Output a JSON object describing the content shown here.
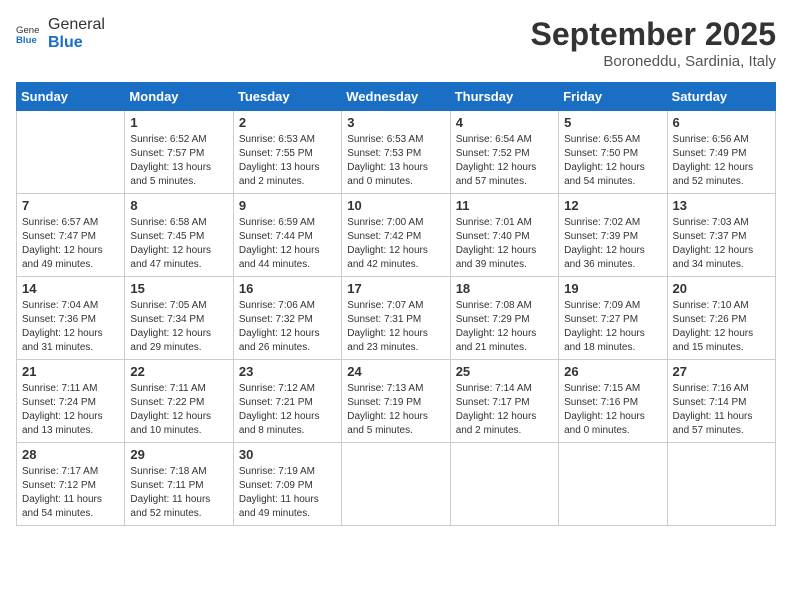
{
  "header": {
    "logo": {
      "general": "General",
      "blue": "Blue",
      "icon_color": "#1a6fc4"
    },
    "title": "September 2025",
    "location": "Boroneddu, Sardinia, Italy"
  },
  "calendar": {
    "days_of_week": [
      "Sunday",
      "Monday",
      "Tuesday",
      "Wednesday",
      "Thursday",
      "Friday",
      "Saturday"
    ],
    "weeks": [
      [
        {
          "day": "",
          "info": ""
        },
        {
          "day": "1",
          "info": "Sunrise: 6:52 AM\nSunset: 7:57 PM\nDaylight: 13 hours\nand 5 minutes."
        },
        {
          "day": "2",
          "info": "Sunrise: 6:53 AM\nSunset: 7:55 PM\nDaylight: 13 hours\nand 2 minutes."
        },
        {
          "day": "3",
          "info": "Sunrise: 6:53 AM\nSunset: 7:53 PM\nDaylight: 13 hours\nand 0 minutes."
        },
        {
          "day": "4",
          "info": "Sunrise: 6:54 AM\nSunset: 7:52 PM\nDaylight: 12 hours\nand 57 minutes."
        },
        {
          "day": "5",
          "info": "Sunrise: 6:55 AM\nSunset: 7:50 PM\nDaylight: 12 hours\nand 54 minutes."
        },
        {
          "day": "6",
          "info": "Sunrise: 6:56 AM\nSunset: 7:49 PM\nDaylight: 12 hours\nand 52 minutes."
        }
      ],
      [
        {
          "day": "7",
          "info": "Sunrise: 6:57 AM\nSunset: 7:47 PM\nDaylight: 12 hours\nand 49 minutes."
        },
        {
          "day": "8",
          "info": "Sunrise: 6:58 AM\nSunset: 7:45 PM\nDaylight: 12 hours\nand 47 minutes."
        },
        {
          "day": "9",
          "info": "Sunrise: 6:59 AM\nSunset: 7:44 PM\nDaylight: 12 hours\nand 44 minutes."
        },
        {
          "day": "10",
          "info": "Sunrise: 7:00 AM\nSunset: 7:42 PM\nDaylight: 12 hours\nand 42 minutes."
        },
        {
          "day": "11",
          "info": "Sunrise: 7:01 AM\nSunset: 7:40 PM\nDaylight: 12 hours\nand 39 minutes."
        },
        {
          "day": "12",
          "info": "Sunrise: 7:02 AM\nSunset: 7:39 PM\nDaylight: 12 hours\nand 36 minutes."
        },
        {
          "day": "13",
          "info": "Sunrise: 7:03 AM\nSunset: 7:37 PM\nDaylight: 12 hours\nand 34 minutes."
        }
      ],
      [
        {
          "day": "14",
          "info": "Sunrise: 7:04 AM\nSunset: 7:36 PM\nDaylight: 12 hours\nand 31 minutes."
        },
        {
          "day": "15",
          "info": "Sunrise: 7:05 AM\nSunset: 7:34 PM\nDaylight: 12 hours\nand 29 minutes."
        },
        {
          "day": "16",
          "info": "Sunrise: 7:06 AM\nSunset: 7:32 PM\nDaylight: 12 hours\nand 26 minutes."
        },
        {
          "day": "17",
          "info": "Sunrise: 7:07 AM\nSunset: 7:31 PM\nDaylight: 12 hours\nand 23 minutes."
        },
        {
          "day": "18",
          "info": "Sunrise: 7:08 AM\nSunset: 7:29 PM\nDaylight: 12 hours\nand 21 minutes."
        },
        {
          "day": "19",
          "info": "Sunrise: 7:09 AM\nSunset: 7:27 PM\nDaylight: 12 hours\nand 18 minutes."
        },
        {
          "day": "20",
          "info": "Sunrise: 7:10 AM\nSunset: 7:26 PM\nDaylight: 12 hours\nand 15 minutes."
        }
      ],
      [
        {
          "day": "21",
          "info": "Sunrise: 7:11 AM\nSunset: 7:24 PM\nDaylight: 12 hours\nand 13 minutes."
        },
        {
          "day": "22",
          "info": "Sunrise: 7:11 AM\nSunset: 7:22 PM\nDaylight: 12 hours\nand 10 minutes."
        },
        {
          "day": "23",
          "info": "Sunrise: 7:12 AM\nSunset: 7:21 PM\nDaylight: 12 hours\nand 8 minutes."
        },
        {
          "day": "24",
          "info": "Sunrise: 7:13 AM\nSunset: 7:19 PM\nDaylight: 12 hours\nand 5 minutes."
        },
        {
          "day": "25",
          "info": "Sunrise: 7:14 AM\nSunset: 7:17 PM\nDaylight: 12 hours\nand 2 minutes."
        },
        {
          "day": "26",
          "info": "Sunrise: 7:15 AM\nSunset: 7:16 PM\nDaylight: 12 hours\nand 0 minutes."
        },
        {
          "day": "27",
          "info": "Sunrise: 7:16 AM\nSunset: 7:14 PM\nDaylight: 11 hours\nand 57 minutes."
        }
      ],
      [
        {
          "day": "28",
          "info": "Sunrise: 7:17 AM\nSunset: 7:12 PM\nDaylight: 11 hours\nand 54 minutes."
        },
        {
          "day": "29",
          "info": "Sunrise: 7:18 AM\nSunset: 7:11 PM\nDaylight: 11 hours\nand 52 minutes."
        },
        {
          "day": "30",
          "info": "Sunrise: 7:19 AM\nSunset: 7:09 PM\nDaylight: 11 hours\nand 49 minutes."
        },
        {
          "day": "",
          "info": ""
        },
        {
          "day": "",
          "info": ""
        },
        {
          "day": "",
          "info": ""
        },
        {
          "day": "",
          "info": ""
        }
      ]
    ]
  }
}
